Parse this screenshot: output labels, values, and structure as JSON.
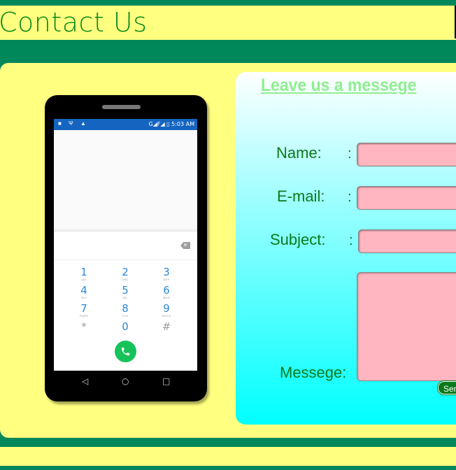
{
  "header": {
    "title": "Contact Us"
  },
  "phone": {
    "status": {
      "left_icons": "■ Ψ ▲",
      "right": "G◢F◢ ▯ 5:03 AM"
    },
    "keys": [
      {
        "digit": "1",
        "letters": "QO"
      },
      {
        "digit": "2",
        "letters": "ABC"
      },
      {
        "digit": "3",
        "letters": "DEF"
      },
      {
        "digit": "4",
        "letters": "GHI"
      },
      {
        "digit": "5",
        "letters": "JKL"
      },
      {
        "digit": "6",
        "letters": "MNO"
      },
      {
        "digit": "7",
        "letters": "PQRS"
      },
      {
        "digit": "8",
        "letters": "TUV"
      },
      {
        "digit": "9",
        "letters": "WXYZ"
      },
      {
        "digit": "*",
        "letters": ""
      },
      {
        "digit": "0",
        "letters": "+"
      },
      {
        "digit": "#",
        "letters": ""
      }
    ],
    "nav": {
      "back": "◁",
      "home": "○",
      "recents": "□"
    }
  },
  "form": {
    "title": "Leave us a messege",
    "name_label": "Name:",
    "email_label": "E-mail:",
    "subject_label": "Subject:",
    "message_label": "Messege:",
    "colon": ":",
    "name_value": "",
    "email_value": "",
    "subject_value": "",
    "message_value": "",
    "send_label": "Send",
    "field_color": "#ffb6c1"
  },
  "colors": {
    "accent": "#00875a",
    "background": "#ffff80",
    "text_green": "#0a7a1a",
    "title_green": "#90ee90"
  }
}
